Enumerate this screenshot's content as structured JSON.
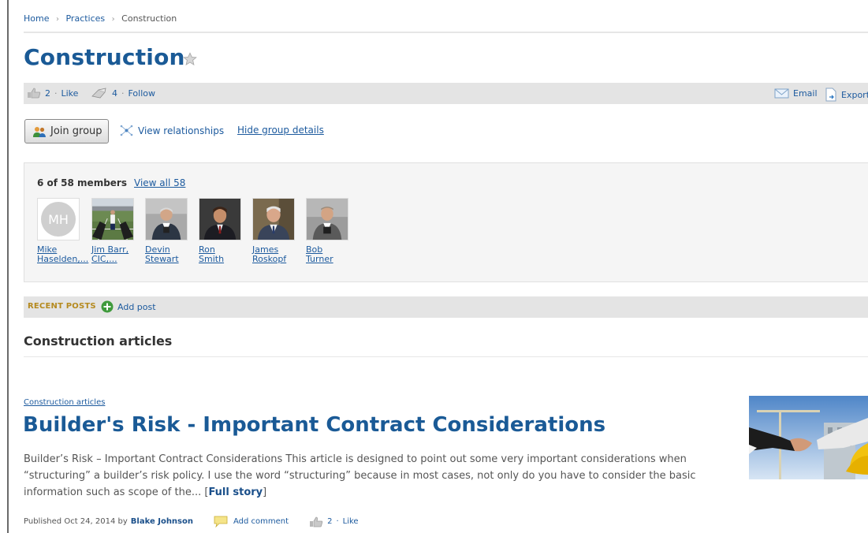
{
  "breadcrumb": {
    "items": [
      "Home",
      "Practices",
      "Construction"
    ]
  },
  "page": {
    "title": "Construction"
  },
  "actions": {
    "like_count": "2",
    "like_label": "Like",
    "follow_count": "4",
    "follow_label": "Follow",
    "email_label": "Email",
    "export_label": "Export"
  },
  "group": {
    "join_label": "Join group",
    "view_relationships_label": "View relationships",
    "hide_details_label": "Hide group details"
  },
  "members": {
    "count_label": "6 of 58 members",
    "view_all_label": "View all 58",
    "items": [
      {
        "first": "Mike",
        "last": "Haselden,...",
        "initials": "MH"
      },
      {
        "first": "Jim Barr,",
        "last": "CIC,..."
      },
      {
        "first": "Devin",
        "last": "Stewart"
      },
      {
        "first": "Ron",
        "last": "Smith"
      },
      {
        "first": "James",
        "last": "Roskopf"
      },
      {
        "first": "Bob",
        "last": "Turner"
      }
    ]
  },
  "recent": {
    "label": "RECENT POSTS",
    "add_label": "Add post"
  },
  "section": {
    "heading": "Construction articles"
  },
  "article": {
    "category": "Construction articles",
    "title": "Builder's Risk - Important Contract Considerations",
    "excerpt": "Builder’s Risk – Important Contract Considerations This article is designed to point out some very important considerations when “structuring” a builder’s risk policy. I use the word “structuring” because in most cases, not only do you have to consider the basic information such as scope of the...",
    "full_story_label": "Full story",
    "published": "Published Oct 24, 2014 by",
    "author": "Blake Johnson",
    "comment_label": "Add comment",
    "like_count": "2",
    "like_label": "Like"
  },
  "colors": {
    "brand_blue": "#1a5a96",
    "link_blue": "#1c5a9e",
    "recent_gold": "#b58a1f",
    "bar_gray": "#e4e4e4"
  }
}
